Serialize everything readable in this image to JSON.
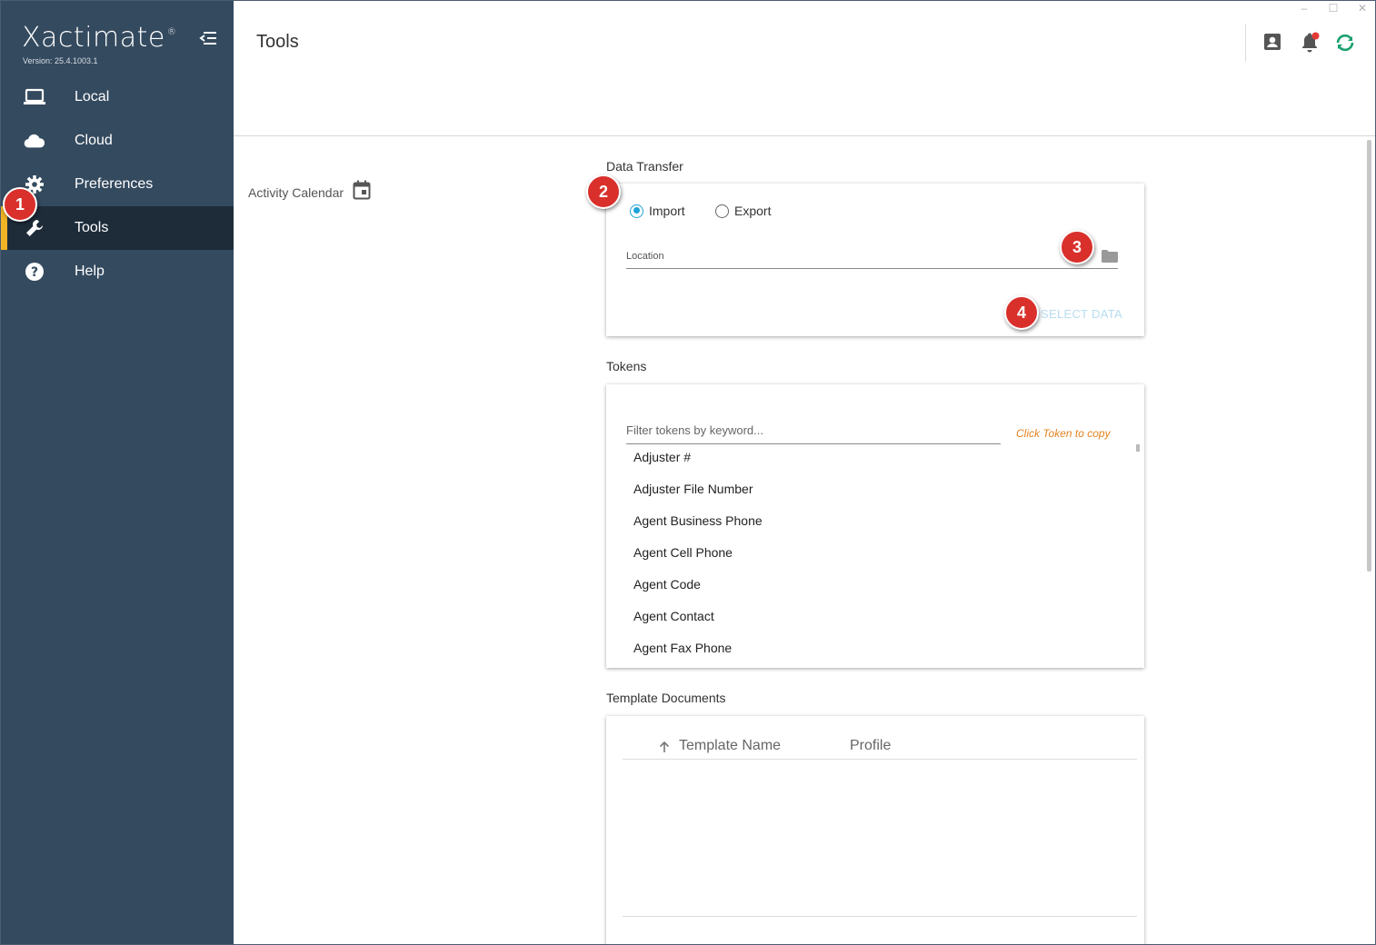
{
  "app": {
    "name": "Xactimate",
    "registered_mark": "®",
    "version": "Version: 25.4.1003.1"
  },
  "sidebar": {
    "items": [
      {
        "label": "Local",
        "icon": "laptop-icon"
      },
      {
        "label": "Cloud",
        "icon": "cloud-icon"
      },
      {
        "label": "Preferences",
        "icon": "gear-icon"
      },
      {
        "label": "Tools",
        "icon": "wrench-icon",
        "active": true
      },
      {
        "label": "Help",
        "icon": "help-icon"
      }
    ]
  },
  "header": {
    "title": "Tools",
    "icons": [
      "contact-icon",
      "notification-bell-icon",
      "sync-icon"
    ]
  },
  "annotations": [
    "1",
    "2",
    "3",
    "4"
  ],
  "activity_calendar": {
    "label": "Activity Calendar",
    "icon": "calendar-icon"
  },
  "data_transfer": {
    "title": "Data Transfer",
    "import_label": "Import",
    "export_label": "Export",
    "selected": "Import",
    "location_label": "Location",
    "select_data_label": "SELECT DATA"
  },
  "tokens": {
    "title": "Tokens",
    "filter_placeholder": "Filter tokens by keyword...",
    "hint": "Click Token to copy",
    "items": [
      "Adjuster #",
      "Adjuster File Number",
      "Agent Business Phone",
      "Agent Cell Phone",
      "Agent Code",
      "Agent Contact",
      "Agent Fax Phone"
    ]
  },
  "template_documents": {
    "title": "Template Documents",
    "columns": [
      "Template Name",
      "Profile"
    ]
  },
  "colors": {
    "sidebar_bg": "#344a5f",
    "sidebar_active_bg": "#1e2c3a",
    "active_accent": "#f0b323",
    "radio_accent": "#1fa3d6",
    "badge": "#d9302c",
    "hint": "#e58322",
    "sync": "#1aa06d"
  }
}
